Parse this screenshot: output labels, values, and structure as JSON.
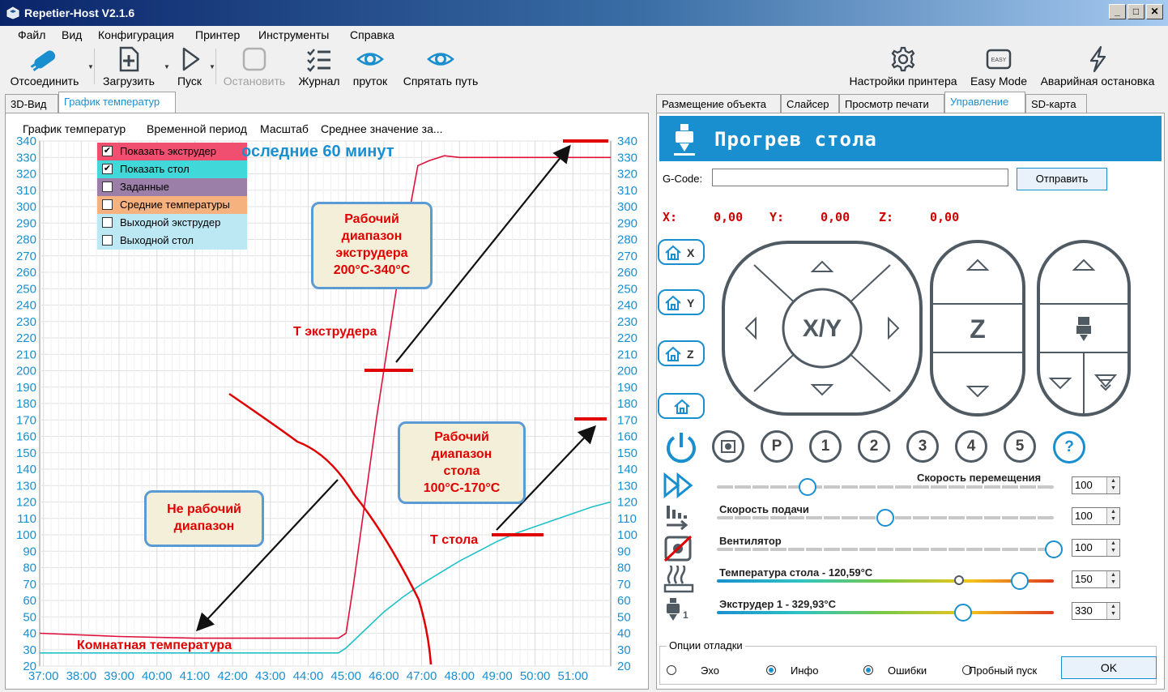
{
  "window": {
    "title": "Repetier-Host V2.1.6",
    "minimize": "_",
    "maximize": "□",
    "close": "✕"
  },
  "menu": [
    "Файл",
    "Вид",
    "Конфигурация",
    "Принтер",
    "Инструменты",
    "Справка"
  ],
  "toolbar": {
    "disconnect": "Отсоединить",
    "load": "Загрузить",
    "start": "Пуск",
    "stop": "Остановить",
    "log": "Журнал",
    "filament": "пруток",
    "hide_path": "Спрятать путь",
    "printer_settings": "Настройки принтера",
    "easy_mode": "Easy Mode",
    "easy_icon_text": "EASY",
    "emergency_stop": "Аварийная остановка"
  },
  "left_tabs": [
    "3D-Вид",
    "График температур"
  ],
  "chart_menu": [
    "График температур",
    "Временной период",
    "Масштаб",
    "Среднее значение за..."
  ],
  "legend": [
    {
      "label": "Показать экструдер",
      "checked": true,
      "color": "#f04f6f"
    },
    {
      "label": "Показать стол",
      "checked": true,
      "color": "#40d8d8"
    },
    {
      "label": "Заданные",
      "checked": false,
      "color": "#9c7fa8"
    },
    {
      "label": "Средние температуры",
      "checked": false,
      "color": "#f6b27e"
    },
    {
      "label": "Выходной экструдер",
      "checked": false,
      "color": "#bce8f4"
    },
    {
      "label": "Выходной стол",
      "checked": false,
      "color": "#bce8f4"
    }
  ],
  "chart_overlay_title": "оследние 60 минут",
  "annotations": {
    "extruder_range": [
      "Рабочий",
      "диапазон",
      "экструдера",
      "200°C-340°C"
    ],
    "bed_range": [
      "Рабочий",
      "диапазон",
      "стола",
      "100°C-170°C"
    ],
    "non_working": [
      "Не рабочий",
      "диапазон"
    ],
    "t_extruder": "Т экструдера",
    "t_bed": "Т стола",
    "room_temp": "Комнатная температура"
  },
  "chart_data": {
    "type": "line",
    "x_ticks": [
      "37:00",
      "38:00",
      "39:00",
      "40:00",
      "41:00",
      "42:00",
      "43:00",
      "44:00",
      "45:00",
      "46:00",
      "47:00",
      "48:00",
      "49:00",
      "50:00",
      "51:00"
    ],
    "ylim": [
      20,
      340
    ],
    "y_ticks": [
      20,
      30,
      40,
      50,
      60,
      70,
      80,
      90,
      100,
      110,
      120,
      130,
      140,
      150,
      160,
      170,
      180,
      190,
      200,
      210,
      220,
      230,
      240,
      250,
      260,
      270,
      280,
      290,
      300,
      310,
      320,
      330,
      340
    ],
    "grid": true,
    "series": [
      {
        "name": "Показать экструдер",
        "color": "#e0103c",
        "x": [
          36.9,
          39.0,
          41.0,
          43.0,
          44.8,
          45.0,
          45.2,
          45.5,
          45.8,
          46.1,
          46.4,
          46.7,
          46.9,
          47.2,
          47.6,
          48.0,
          49.0,
          50.0,
          51.0,
          52.0
        ],
        "y": [
          40,
          38,
          37,
          37,
          37,
          40,
          70,
          120,
          170,
          215,
          260,
          300,
          325,
          328,
          331,
          330,
          330,
          330,
          330,
          330
        ]
      },
      {
        "name": "Показать стол",
        "color": "#20c0c8",
        "x": [
          36.9,
          39.0,
          41.0,
          43.0,
          44.8,
          45.0,
          45.5,
          46.0,
          46.5,
          47.0,
          47.5,
          48.0,
          48.5,
          49.0,
          49.5,
          50.0,
          50.5,
          51.0,
          51.5,
          52.0
        ],
        "y": [
          28,
          28,
          28,
          28,
          28,
          31,
          42,
          53,
          62,
          70,
          77,
          84,
          90,
          96,
          101,
          105,
          109,
          113,
          117,
          120
        ]
      }
    ]
  },
  "right_tabs": [
    "Размещение объекта",
    "Слайсер",
    "Просмотр печати",
    "Управление",
    "SD-карта"
  ],
  "control": {
    "header": "Прогрев стола",
    "gcode_label": "G-Code:",
    "gcode_value": "",
    "send": "Отправить",
    "x_label": "X:",
    "x_value": "0,00",
    "y_label": "Y:",
    "y_value": "0,00",
    "z_label": "Z:",
    "z_value": "0,00",
    "home_x": "X",
    "home_y": "Y",
    "home_z": "Z",
    "xy_label": "X/Y",
    "z_label_pad": "Z",
    "buttons": [
      "P",
      "1",
      "2",
      "3",
      "4",
      "5",
      "?"
    ],
    "sliders": [
      {
        "label": "Скорость перемещения",
        "value": "100",
        "fraction": 0.27
      },
      {
        "label": "Скорость подачи",
        "value": "100",
        "fraction": 0.5
      },
      {
        "label": "Вентилятор",
        "value": "100",
        "fraction": 1.0
      },
      {
        "label": "Температура стола - 120,59°C",
        "value": "150",
        "fraction": 0.9,
        "current_fraction": 0.72
      },
      {
        "label": "Экструдер 1 - 329,93°C",
        "value": "330",
        "fraction": 0.73
      }
    ],
    "extruder_index": "1",
    "debug_title": "Опции отладки",
    "debug": [
      {
        "label": "Эхо",
        "on": false
      },
      {
        "label": "Инфо",
        "on": true
      },
      {
        "label": "Ошибки",
        "on": true
      },
      {
        "label": "Пробный пуск",
        "on": false
      }
    ],
    "ok": "OK"
  }
}
